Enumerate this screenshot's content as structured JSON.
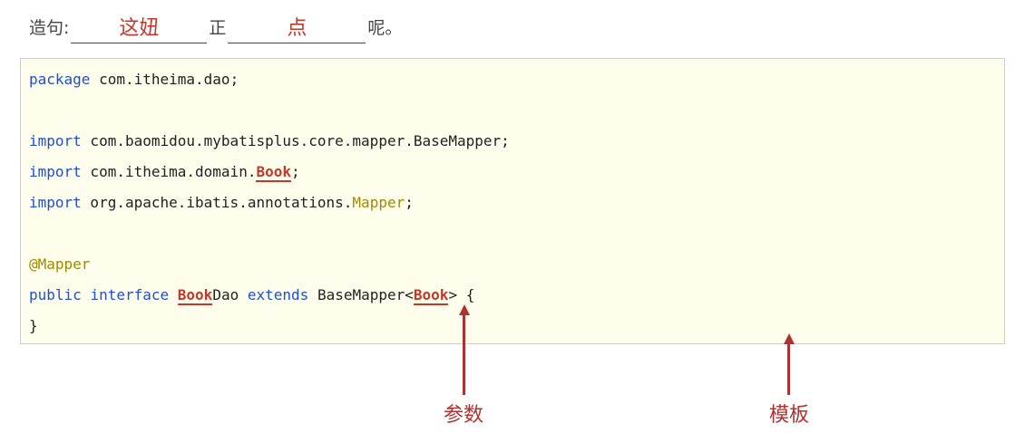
{
  "sentence": {
    "prefix": "造句:",
    "blank1": "这妞",
    "middle": "正",
    "blank2": "点",
    "suffix": "呢。"
  },
  "code": {
    "line1": {
      "kw": "package",
      "rest": " com.itheima.dao;"
    },
    "line2": {
      "kw": "import",
      "rest": " com.baomidou.mybatisplus.core.mapper.BaseMapper;"
    },
    "line3": {
      "kw": "import",
      "rest": " com.itheima.domain.",
      "hl": "Book",
      "end": ";"
    },
    "line4": {
      "kw": "import",
      "rest": " org.apache.ibatis.annotations.",
      "ann": "Mapper",
      "end": ";"
    },
    "line5": {
      "ann": "@Mapper"
    },
    "line6": {
      "kw1": "public",
      "kw2": "interface",
      "hl1": "Book",
      "name_rest": "Dao",
      "kw3": "extends",
      "base": "BaseMapper<",
      "hl2": "Book",
      "end": "> {"
    },
    "line7": {
      "text": "}"
    }
  },
  "labels": {
    "param": "参数",
    "template": "模板"
  },
  "colors": {
    "highlight": "#c0392b",
    "keyword": "#1f4fd1",
    "annotation": "#a08a00",
    "arrow": "#b03030",
    "box_bg": "#fffdeb"
  }
}
